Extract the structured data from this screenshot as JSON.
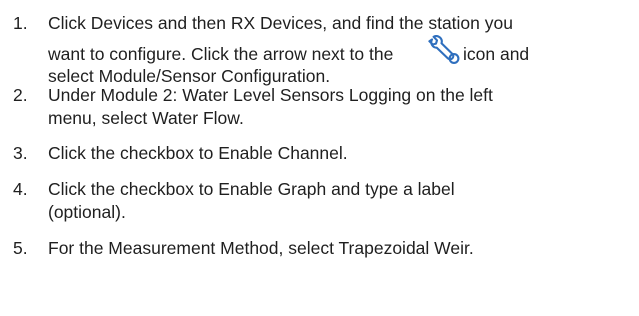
{
  "document": {
    "steps": [
      {
        "number": "1.",
        "lines": [
          "Click Devices and then RX Devices, and find the station you",
          "want to configure. Click the arrow next to the",
          "icon and",
          "select Module/Sensor Configuration."
        ],
        "icon": "wrench-settings-icon"
      },
      {
        "number": "2.",
        "lines": [
          "Under Module 2: Water Level Sensors Logging on the left",
          "menu, select Water Flow."
        ]
      },
      {
        "number": "3.",
        "lines": [
          "Click the checkbox to Enable Channel."
        ]
      },
      {
        "number": "4.",
        "lines": [
          "Click the checkbox to Enable Graph and type a label",
          "(optional)."
        ]
      },
      {
        "number": "5.",
        "lines": [
          "For the Measurement Method, select Trapezoidal Weir."
        ]
      }
    ]
  },
  "colors": {
    "text": "#1f1f1f",
    "icon": "#2f6fbe"
  }
}
